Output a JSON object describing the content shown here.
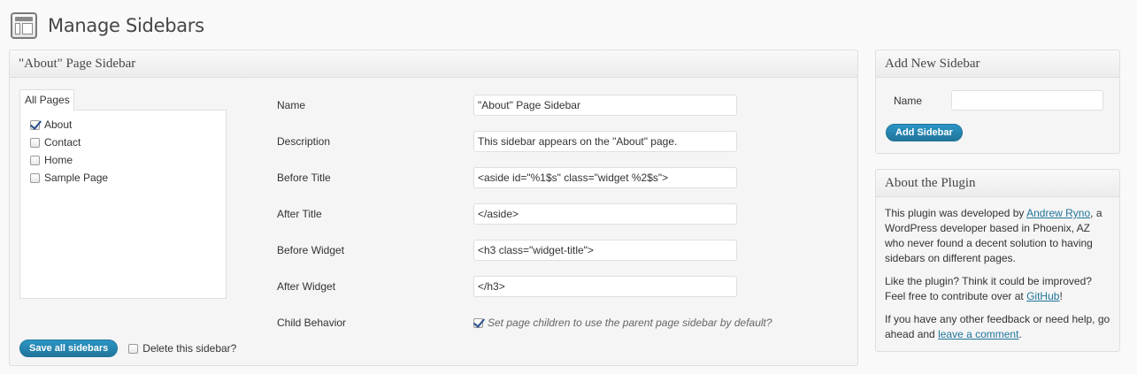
{
  "header": {
    "title": "Manage Sidebars",
    "icon": "sidebar-layout-icon"
  },
  "main_box": {
    "title": "\"About\" Page Sidebar",
    "tab_label": "All Pages",
    "pages": [
      {
        "label": "About",
        "checked": true
      },
      {
        "label": "Contact",
        "checked": false
      },
      {
        "label": "Home",
        "checked": false
      },
      {
        "label": "Sample Page",
        "checked": false
      }
    ],
    "fields": {
      "name": {
        "label": "Name",
        "value": "\"About\" Page Sidebar"
      },
      "description": {
        "label": "Description",
        "value": "This sidebar appears on the \"About\" page."
      },
      "before_title": {
        "label": "Before Title",
        "value": "<aside id=\"%1$s\" class=\"widget %2$s\">"
      },
      "after_title": {
        "label": "After Title",
        "value": "</aside>"
      },
      "before_widget": {
        "label": "Before Widget",
        "value": "<h3 class=\"widget-title\">"
      },
      "after_widget": {
        "label": "After Widget",
        "value": "</h3>"
      }
    },
    "child_behavior": {
      "label": "Child Behavior",
      "checked": true,
      "description": "Set page children to use the parent page sidebar by default?"
    },
    "save_button": "Save all sidebars",
    "delete_label": "Delete this sidebar?"
  },
  "add_box": {
    "title": "Add New Sidebar",
    "name_label": "Name",
    "name_value": "",
    "button": "Add Sidebar"
  },
  "about_box": {
    "title": "About the Plugin",
    "p1_before": "This plugin was developed by ",
    "p1_link": "Andrew Ryno",
    "p1_after": ", a WordPress developer based in Phoenix, AZ who never found a decent solution to having sidebars on different pages.",
    "p2_before": "Like the plugin? Think it could be improved? Feel free to contribute over at ",
    "p2_link": "GitHub",
    "p2_after": "!",
    "p3_before": "If you have any other feedback or need help, go ahead and ",
    "p3_link": "leave a comment",
    "p3_after": "."
  },
  "colors": {
    "accent": "#21759b",
    "link": "#21759b",
    "background": "#f9f9f9"
  }
}
